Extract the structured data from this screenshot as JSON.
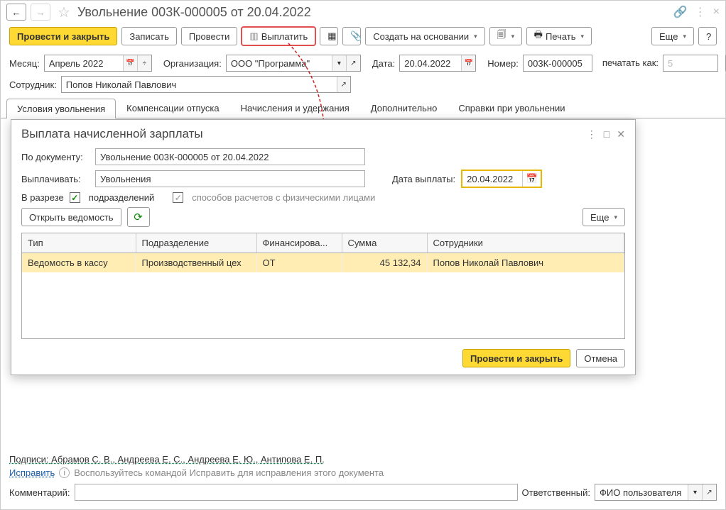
{
  "header": {
    "title": "Увольнение 003К-000005 от 20.04.2022"
  },
  "toolbar": {
    "post_close": "Провести и закрыть",
    "save": "Записать",
    "post": "Провести",
    "pay": "Выплатить",
    "create_based": "Создать на основании",
    "print": "Печать",
    "more": "Еще",
    "help": "?"
  },
  "form": {
    "month_label": "Месяц:",
    "month_value": "Апрель 2022",
    "org_label": "Организация:",
    "org_value": "ООО \"Программа\"",
    "date_label": "Дата:",
    "date_value": "20.04.2022",
    "number_label": "Номер:",
    "number_value": "003К-000005",
    "print_as_label": "печатать как:",
    "print_as_value": "5",
    "employee_label": "Сотрудник:",
    "employee_value": "Попов Николай Павлович"
  },
  "tabs": [
    "Условия увольнения",
    "Компенсации отпуска",
    "Начисления и удержания",
    "Дополнительно",
    "Справки при увольнении"
  ],
  "dialog": {
    "title": "Выплата начисленной зарплаты",
    "by_doc_label": "По документу:",
    "by_doc_value": "Увольнение 003К-000005 от 20.04.2022",
    "pay_label": "Выплачивать:",
    "pay_value": "Увольнения",
    "pay_date_label": "Дата выплаты:",
    "pay_date_value": "20.04.2022",
    "split_label": "В разрезе",
    "cb_dept": "подразделений",
    "cb_method": "способов расчетов с физическими лицами",
    "open_sheet": "Открыть ведомость",
    "more": "Еще",
    "cols": {
      "type": "Тип",
      "dept": "Подразделение",
      "fin": "Финансирова...",
      "sum": "Сумма",
      "emp": "Сотрудники"
    },
    "row": {
      "type": "Ведомость в кассу",
      "dept": "Производственный цех",
      "fin": "ОТ",
      "sum": "45 132,34",
      "emp": "Попов Николай Павлович"
    },
    "ok": "Провести и закрыть",
    "cancel": "Отмена"
  },
  "footer": {
    "sign_label": "Подписи: ",
    "sign_names": "Абрамов С. В., Андреева Е. С., Андреева Е. Ю., Антипова Е. П.",
    "fix_link": "Исправить",
    "fix_hint": "Воспользуйтесь командой Исправить для исправления этого документа",
    "comment_label": "Комментарий:",
    "resp_label": "Ответственный:",
    "resp_value": "ФИО пользователя"
  }
}
